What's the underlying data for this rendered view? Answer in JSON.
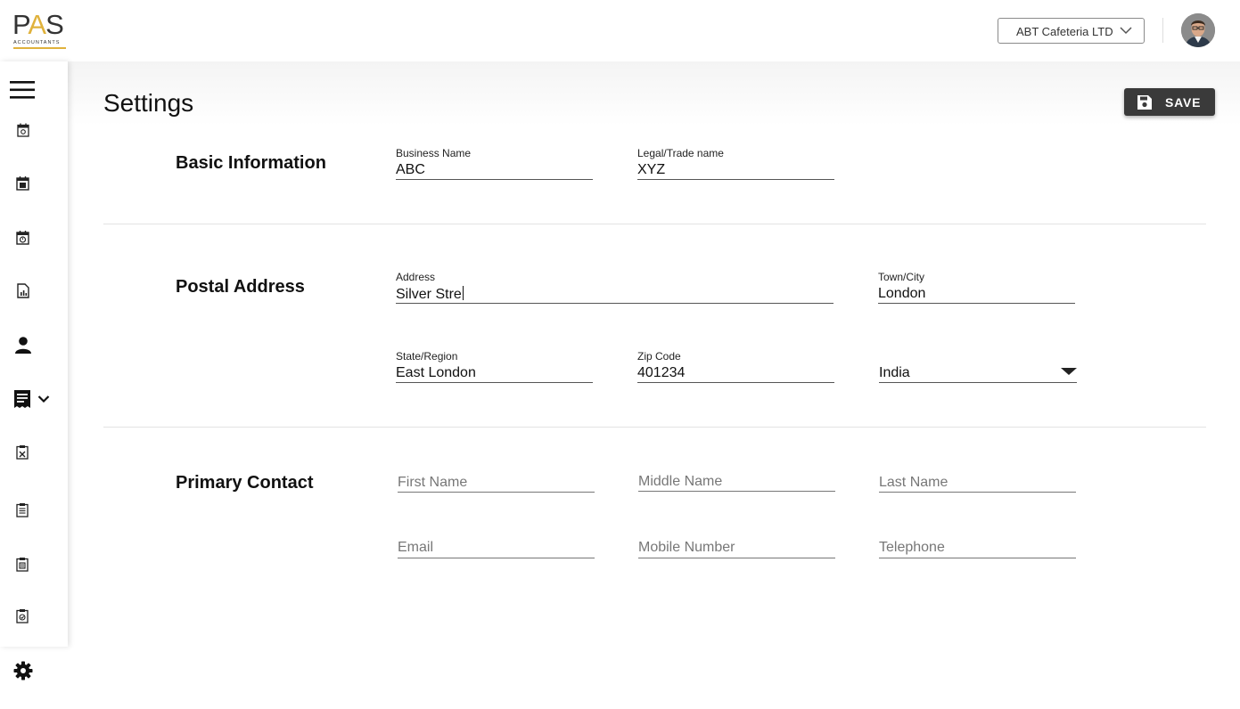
{
  "brand": {
    "logo_text": "PAS",
    "logo_subtext": "ACCOUNTANTS",
    "accent_color": "#e0b23c"
  },
  "header": {
    "company_selector": "ABT Cafeteria LTD",
    "avatar_icon": "user-avatar"
  },
  "sidebar": {
    "items": [
      {
        "icon": "menu-icon"
      },
      {
        "icon": "calendar-icon"
      },
      {
        "icon": "calendar-edit-icon"
      },
      {
        "icon": "calendar-clock-icon"
      },
      {
        "icon": "report-icon"
      },
      {
        "icon": "person-icon"
      },
      {
        "icon": "receipt-icon"
      },
      {
        "icon": "clipboard-icon"
      },
      {
        "icon": "clipboard-list-icon"
      },
      {
        "icon": "clipboard-doc-icon"
      },
      {
        "icon": "clipboard-check-icon"
      },
      {
        "icon": "gear-icon"
      }
    ]
  },
  "page": {
    "title": "Settings",
    "save_label": "SAVE"
  },
  "basic_info": {
    "title": "Basic Information",
    "business_name_label": "Business Name",
    "business_name_value": "ABC",
    "legal_name_label": "Legal/Trade name",
    "legal_name_value": "XYZ"
  },
  "postal": {
    "title": "Postal Address",
    "address_label": "Address",
    "address_value": "Silver Stre",
    "town_label": "Town/City",
    "town_value": "London",
    "state_label": "State/Region",
    "state_value": "East London",
    "zip_label": "Zip Code",
    "zip_value": "401234",
    "country_value": "India"
  },
  "contact": {
    "title": "Primary Contact",
    "first_name_placeholder": "First Name",
    "middle_name_placeholder": "Middle Name",
    "last_name_placeholder": "Last Name",
    "email_placeholder": "Email",
    "mobile_placeholder": "Mobile Number",
    "telephone_placeholder": "Telephone"
  }
}
